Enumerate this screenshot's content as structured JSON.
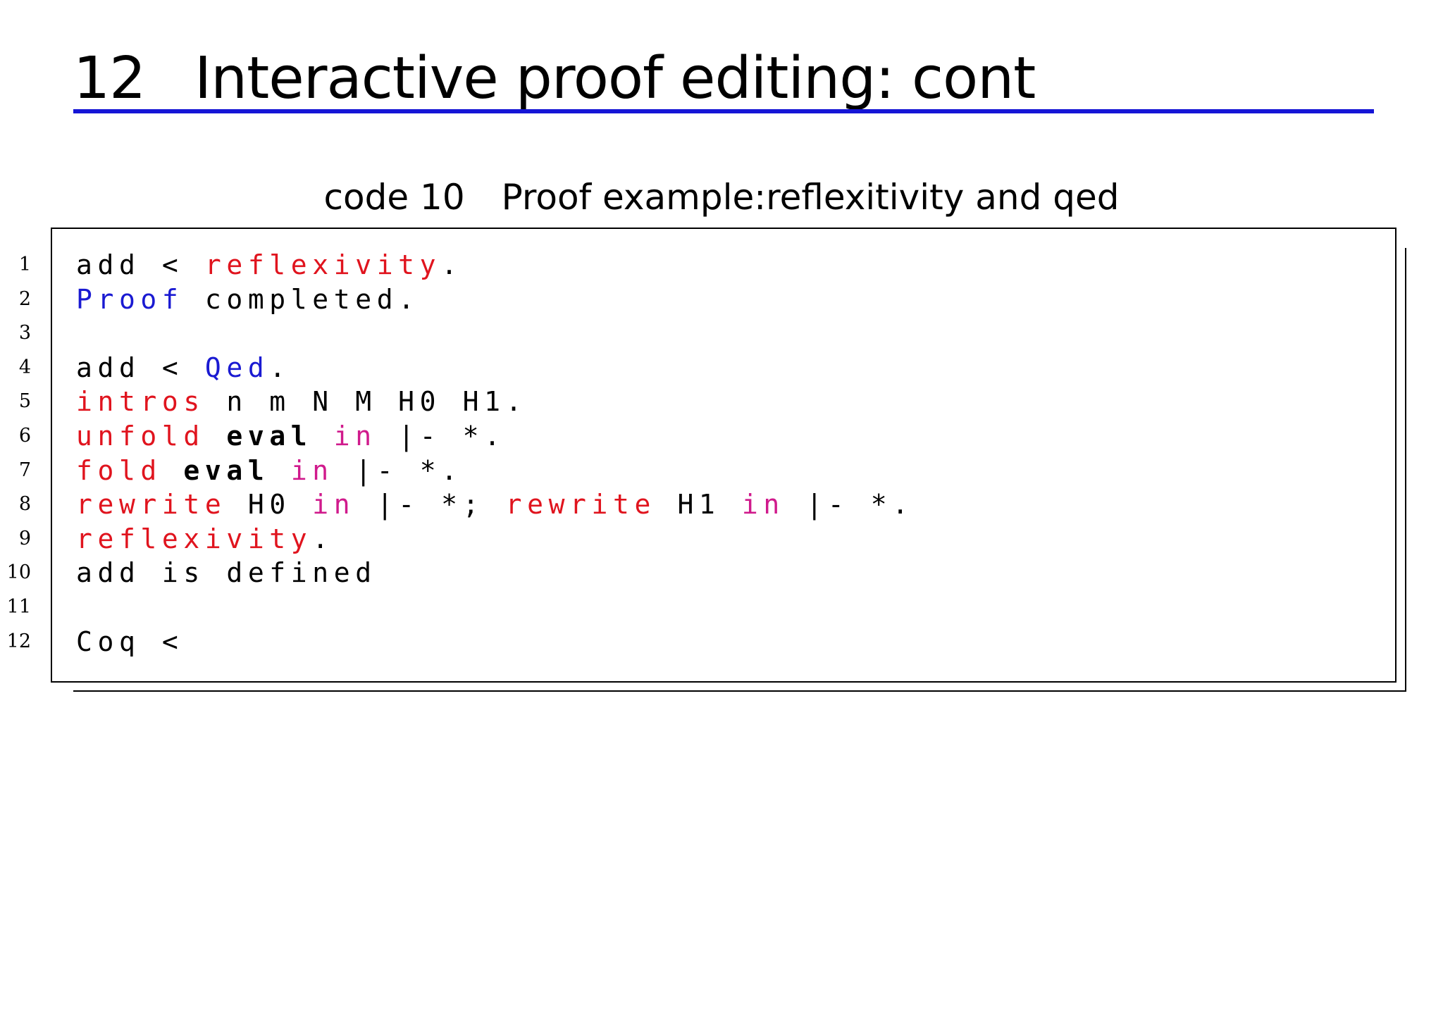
{
  "slide": {
    "number": "12",
    "title": "Interactive proof editing: cont"
  },
  "caption": {
    "label": "code 10",
    "text": "Proof example:reflexitivity and qed"
  },
  "colors": {
    "title_rule": "#1515d6",
    "tactic": "#e0141e",
    "command": "#1a1ad2",
    "keyword_in": "#d01a8c"
  },
  "code": {
    "line_numbers": [
      "1",
      "2",
      "3",
      "4",
      "5",
      "6",
      "7",
      "8",
      "9",
      "10",
      "11",
      "12"
    ],
    "lines": [
      [
        {
          "t": "add < ",
          "c": ""
        },
        {
          "t": "reflexivity",
          "c": "kw-red"
        },
        {
          "t": ".",
          "c": ""
        }
      ],
      [
        {
          "t": "Proof",
          "c": "kw-blue"
        },
        {
          "t": " completed.",
          "c": ""
        }
      ],
      [],
      [
        {
          "t": "add < ",
          "c": ""
        },
        {
          "t": "Qed",
          "c": "kw-blue"
        },
        {
          "t": ".",
          "c": ""
        }
      ],
      [
        {
          "t": "intros",
          "c": "kw-red"
        },
        {
          "t": " n m N M H0 H1.",
          "c": ""
        }
      ],
      [
        {
          "t": "unfold",
          "c": "kw-red"
        },
        {
          "t": " ",
          "c": ""
        },
        {
          "t": "eval",
          "c": "kw-bold"
        },
        {
          "t": " ",
          "c": ""
        },
        {
          "t": "in",
          "c": "kw-magenta"
        },
        {
          "t": " |- *.",
          "c": ""
        }
      ],
      [
        {
          "t": "fold",
          "c": "kw-red"
        },
        {
          "t": " ",
          "c": ""
        },
        {
          "t": "eval",
          "c": "kw-bold"
        },
        {
          "t": " ",
          "c": ""
        },
        {
          "t": "in",
          "c": "kw-magenta"
        },
        {
          "t": " |- *.",
          "c": ""
        }
      ],
      [
        {
          "t": "rewrite",
          "c": "kw-red"
        },
        {
          "t": " H0 ",
          "c": ""
        },
        {
          "t": "in",
          "c": "kw-magenta"
        },
        {
          "t": " |- *; ",
          "c": ""
        },
        {
          "t": "rewrite",
          "c": "kw-red"
        },
        {
          "t": " H1 ",
          "c": ""
        },
        {
          "t": "in",
          "c": "kw-magenta"
        },
        {
          "t": " |- *.",
          "c": ""
        }
      ],
      [
        {
          "t": "reflexivity",
          "c": "kw-red"
        },
        {
          "t": ".",
          "c": ""
        }
      ],
      [
        {
          "t": "add is defined",
          "c": ""
        }
      ],
      [],
      [
        {
          "t": "Coq < ",
          "c": ""
        }
      ]
    ]
  }
}
